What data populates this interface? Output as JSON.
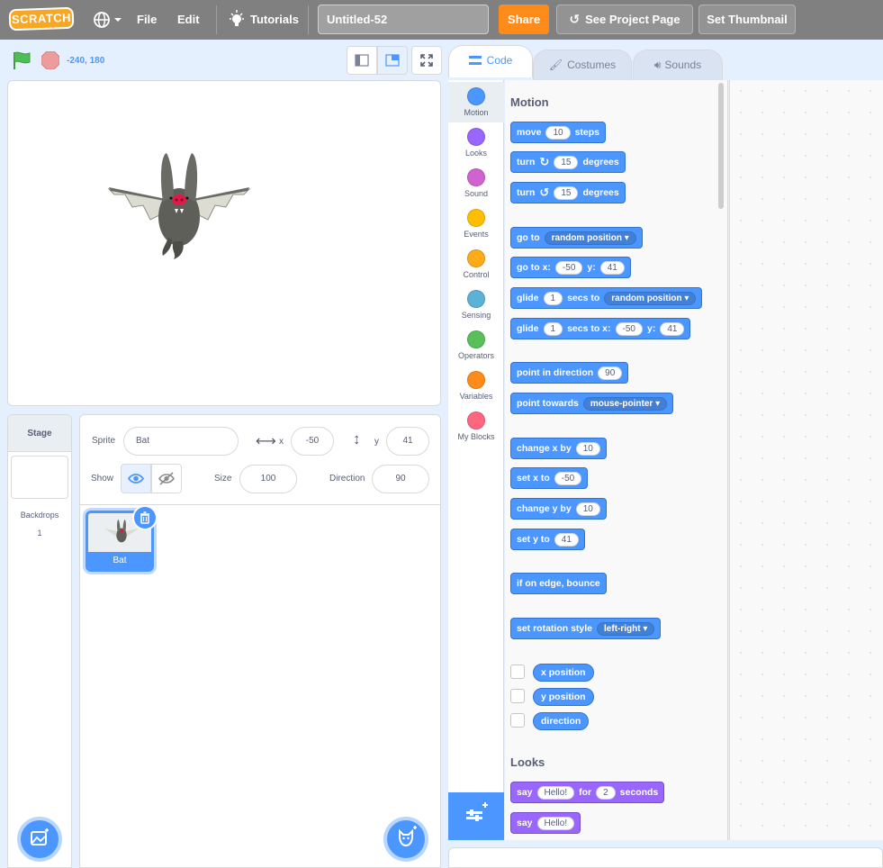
{
  "menubar": {
    "logo": "SCRATCH",
    "file": "File",
    "edit": "Edit",
    "tutorials": "Tutorials",
    "project_title": "Untitled-52",
    "share": "Share",
    "see_project_page": "See Project Page",
    "set_thumbnail": "Set Thumbnail"
  },
  "stage_header": {
    "coords": "-240, 180"
  },
  "tabs": {
    "code": "Code",
    "costumes": "Costumes",
    "sounds": "Sounds"
  },
  "categories": [
    {
      "label": "Motion",
      "color": "#4c97ff"
    },
    {
      "label": "Looks",
      "color": "#9966ff"
    },
    {
      "label": "Sound",
      "color": "#cf63cf"
    },
    {
      "label": "Events",
      "color": "#ffbf00"
    },
    {
      "label": "Control",
      "color": "#ffab19"
    },
    {
      "label": "Sensing",
      "color": "#5cb1d6"
    },
    {
      "label": "Operators",
      "color": "#59c059"
    },
    {
      "label": "Variables",
      "color": "#ff8c1a"
    },
    {
      "label": "My Blocks",
      "color": "#ff6680"
    }
  ],
  "palette": {
    "motion_title": "Motion",
    "looks_title": "Looks",
    "move": {
      "a": "move",
      "v": "10",
      "b": "steps"
    },
    "turn_right": {
      "a": "turn",
      "v": "15",
      "b": "degrees"
    },
    "turn_left": {
      "a": "turn",
      "v": "15",
      "b": "degrees"
    },
    "goto": {
      "a": "go to",
      "dd": "random position"
    },
    "gotoxy": {
      "a": "go to x:",
      "x": "-50",
      "b": "y:",
      "y": "41"
    },
    "glide_to": {
      "a": "glide",
      "v": "1",
      "b": "secs to",
      "dd": "random position"
    },
    "glide_xy": {
      "a": "glide",
      "v": "1",
      "b": "secs to x:",
      "x": "-50",
      "c": "y:",
      "y": "41"
    },
    "point_dir": {
      "a": "point in direction",
      "v": "90"
    },
    "point_towards": {
      "a": "point towards",
      "dd": "mouse-pointer"
    },
    "change_x": {
      "a": "change x by",
      "v": "10"
    },
    "set_x": {
      "a": "set x to",
      "v": "-50"
    },
    "change_y": {
      "a": "change y by",
      "v": "10"
    },
    "set_y": {
      "a": "set y to",
      "v": "41"
    },
    "bounce": {
      "a": "if on edge, bounce"
    },
    "rotation": {
      "a": "set rotation style",
      "dd": "left-right"
    },
    "x_position": "x position",
    "y_position": "y position",
    "direction": "direction",
    "say_for": {
      "a": "say",
      "v": "Hello!",
      "b": "for",
      "n": "2",
      "c": "seconds"
    },
    "say": {
      "a": "say",
      "v": "Hello!"
    }
  },
  "sprite_info": {
    "sprite_label": "Sprite",
    "sprite_name": "Bat",
    "x_label": "x",
    "x_value": "-50",
    "y_label": "y",
    "y_value": "41",
    "show_label": "Show",
    "size_label": "Size",
    "size_value": "100",
    "direction_label": "Direction",
    "direction_value": "90"
  },
  "stage_panel": {
    "title": "Stage",
    "backdrops_label": "Backdrops",
    "backdrops_count": "1"
  },
  "sprites": [
    {
      "name": "Bat"
    }
  ]
}
